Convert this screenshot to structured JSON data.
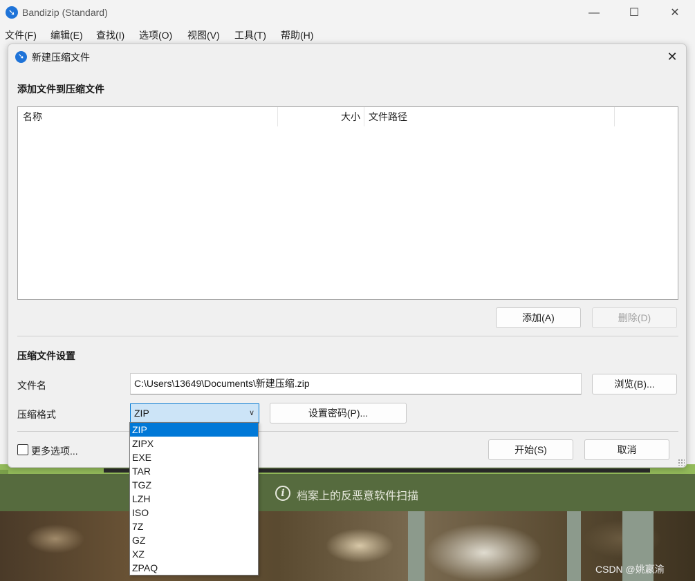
{
  "window": {
    "title": "Bandizip (Standard)",
    "minimize": "—",
    "maximize": "☐",
    "close": "✕"
  },
  "menu": [
    "文件(F)",
    "编辑(E)",
    "查找(I)",
    "选项(O)",
    "视图(V)",
    "工具(T)",
    "帮助(H)"
  ],
  "dialog": {
    "title": "新建压缩文件",
    "close": "✕",
    "add_section_title": "添加文件到压缩文件",
    "columns": {
      "name": "名称",
      "size": "大小",
      "path": "文件路径"
    },
    "add_button": "添加(A)",
    "delete_button": "删除(D)",
    "settings_title": "压缩文件设置",
    "filename_label": "文件名",
    "filename_value": "C:\\Users\\13649\\Documents\\新建压缩.zip",
    "browse_button": "浏览(B)...",
    "format_label": "压缩格式",
    "format_value": "ZIP",
    "password_button": "设置密码(P)...",
    "more_options": "更多选项...",
    "start_button": "开始(S)",
    "cancel_button": "取消"
  },
  "format_options": [
    "ZIP",
    "ZIPX",
    "EXE",
    "TAR",
    "TGZ",
    "LZH",
    "ISO",
    "7Z",
    "GZ",
    "XZ",
    "ZPAQ"
  ],
  "format_selected_index": 0,
  "background": {
    "scan_text": "档案上的反恶意软件扫描",
    "info_icon_glyph": "i",
    "watermark": "CSDN @姚嬴渝"
  },
  "colors": {
    "accent": "#0078d7",
    "select_bg": "#cce4f7",
    "band": "#566b3e"
  }
}
